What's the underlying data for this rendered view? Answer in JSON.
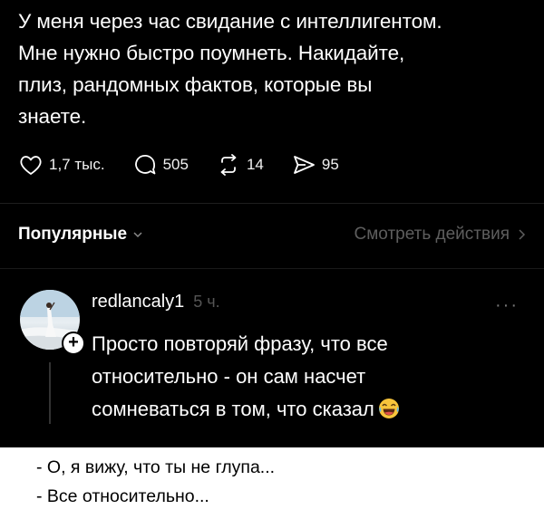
{
  "post": {
    "lines": [
      "У меня через час свидание с интеллигентом.",
      "Мне нужно быстро поумнеть. Накидайте,",
      "плиз, рандомных фактов, которые вы",
      "знаете."
    ]
  },
  "actions": {
    "likes": "1,7 тыс.",
    "comments": "505",
    "reposts": "14",
    "shares": "95",
    "icons": [
      "heart-icon",
      "comment-icon",
      "repost-icon",
      "share-icon"
    ]
  },
  "filters": {
    "sort_label": "Популярные",
    "see_actions_label": "Смотреть действия"
  },
  "reply": {
    "username": "redlancaly1",
    "time": "5 ч.",
    "more": "···",
    "plus": "+",
    "lines": [
      "Просто повторяй фразу, что все",
      "относительно - он сам насчет",
      "сомневаться в том, что сказал"
    ],
    "emoji": "laughing-emoji-icon"
  },
  "caption": {
    "line1": "- О, я вижу, что ты не глупа...",
    "line2": "- Все относительно..."
  },
  "colors": {
    "background": "#000000",
    "muted": "#5e5e5e",
    "caption_bg": "#ffffff"
  }
}
